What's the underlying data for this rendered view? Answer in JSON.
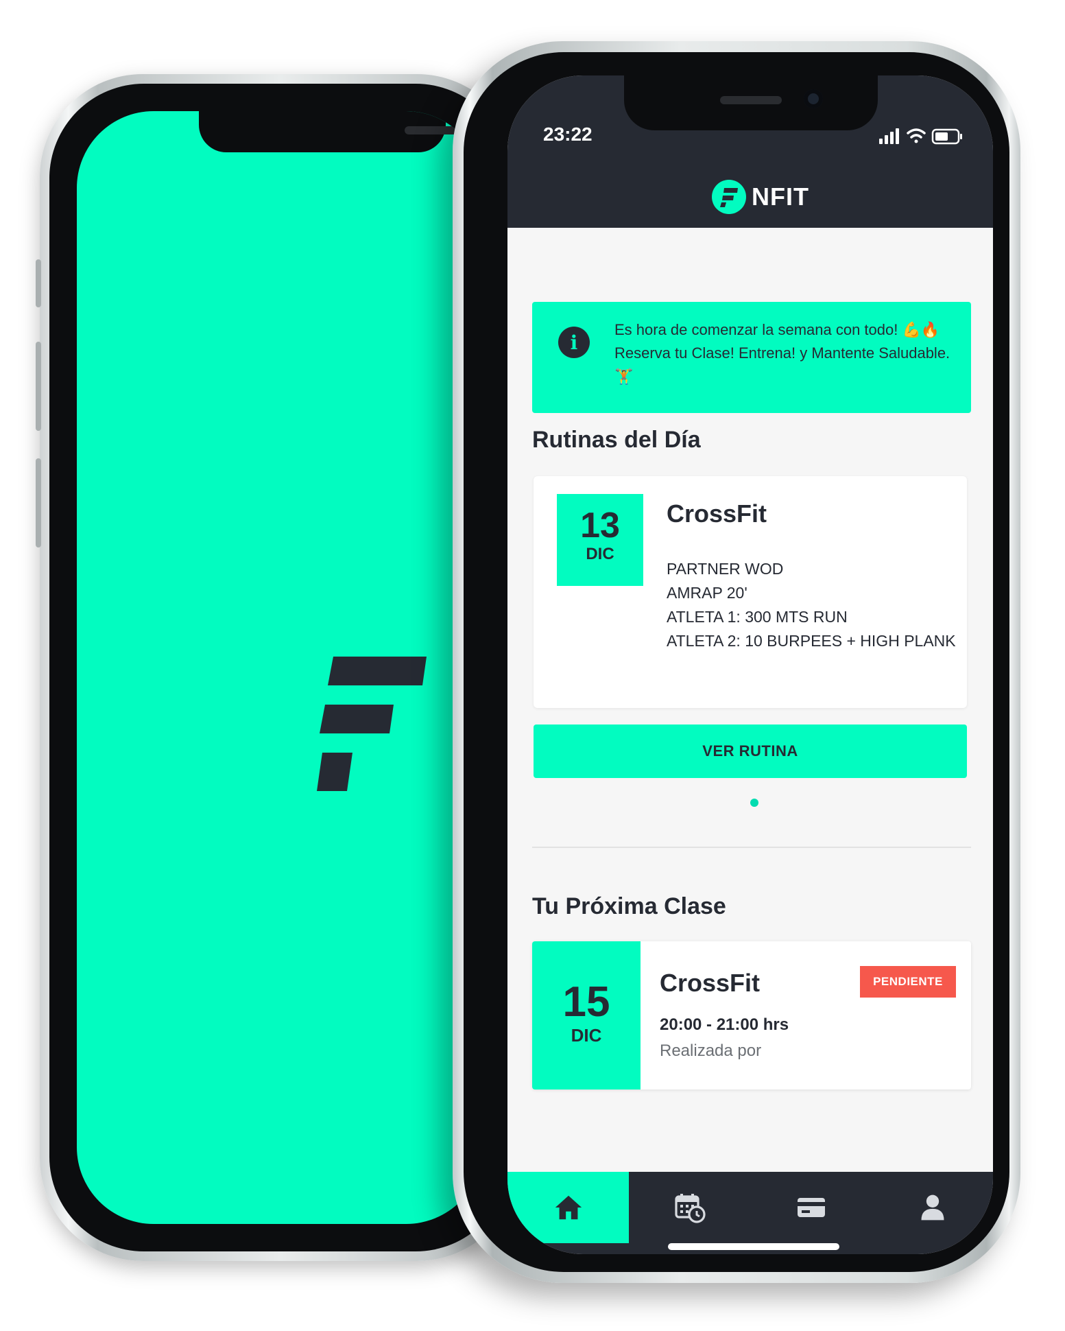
{
  "status_bar": {
    "time": "23:22"
  },
  "header": {
    "brand": "NFIT"
  },
  "alert": {
    "message_line1": "Es hora de comenzar la semana con todo! 💪🔥",
    "message_line2": "Reserva tu Clase! Entrena! y Mantente Saludable.",
    "message_line3": "🏋",
    "icon": "info-icon"
  },
  "routines": {
    "title": "Rutinas del Día",
    "card": {
      "day": "13",
      "month": "DIC",
      "name": "CrossFit",
      "lines": [
        "PARTNER WOD",
        "AMRAP 20'",
        "ATLETA 1: 300 MTS RUN",
        "ATLETA 2: 10 BURPEES + HIGH PLANK"
      ]
    },
    "button_label": "VER RUTINA"
  },
  "next_class": {
    "title": "Tu Próxima Clase",
    "day": "15",
    "month": "DIC",
    "name": "CrossFit",
    "status": "PENDIENTE",
    "hours": "20:00 - 21:00 hrs",
    "by": "Realizada por"
  },
  "bottom_nav": [
    {
      "icon": "home-icon",
      "active": true
    },
    {
      "icon": "calendar-clock-icon",
      "active": false
    },
    {
      "icon": "credit-card-icon",
      "active": false
    },
    {
      "icon": "user-icon",
      "active": false
    }
  ],
  "colors": {
    "accent": "#02fcc0",
    "dark": "#262a33",
    "badge": "#f6584c",
    "background": "#f6f6f6"
  }
}
